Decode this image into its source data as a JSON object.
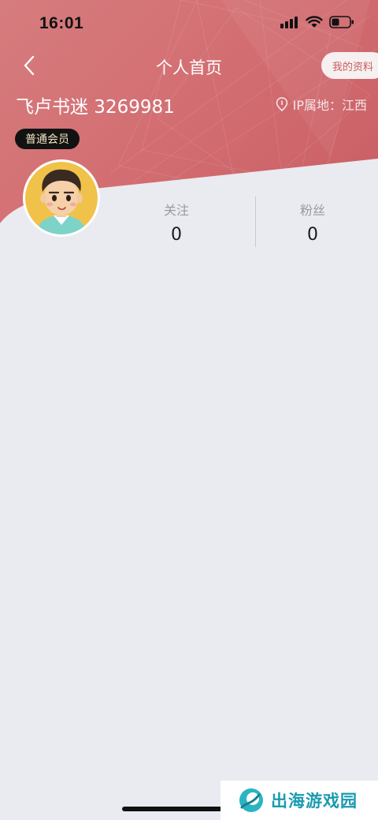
{
  "status_bar": {
    "time": "16:01",
    "icons": [
      "cellular-signal-icon",
      "wifi-icon",
      "battery-icon"
    ]
  },
  "nav": {
    "back_icon": "chevron-left-icon",
    "title": "个人首页",
    "profile_button_label": "我的资料"
  },
  "profile": {
    "username": "飞卢书迷 3269981",
    "ip_location": "IP属地：江西",
    "location_icon": "location-pin-icon",
    "member_badge": "普通会员"
  },
  "stats": {
    "following_label": "关注",
    "following_value": "0",
    "fans_label": "粉丝",
    "fans_value": "0"
  },
  "watermark": {
    "text": "出海游戏园"
  },
  "colors": {
    "header": "#d36f73",
    "background": "#eaebf0",
    "badge": "#121212",
    "watermark": "#1a9bb0"
  }
}
